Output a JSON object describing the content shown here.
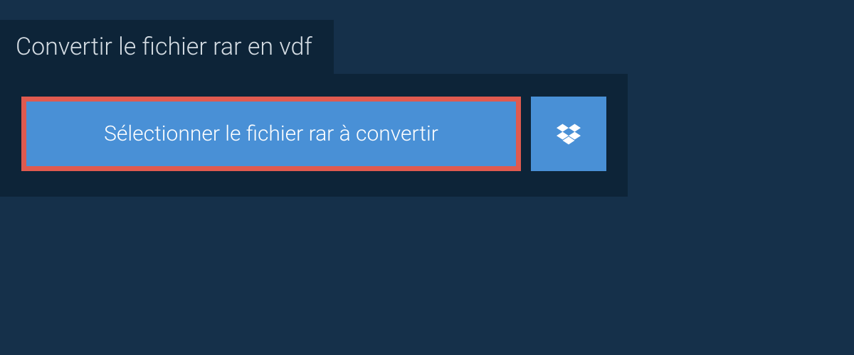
{
  "header": {
    "title": "Convertir le fichier rar en vdf"
  },
  "actions": {
    "select_file_label": "Sélectionner le fichier rar à convertir"
  },
  "colors": {
    "background": "#15304a",
    "panel": "#0d2438",
    "button": "#4990d6",
    "highlight_border": "#e05a4f"
  }
}
